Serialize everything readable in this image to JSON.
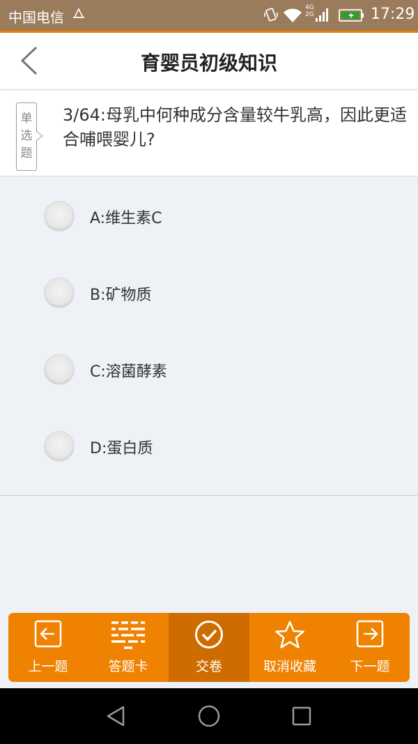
{
  "status_bar": {
    "carrier": "中国电信",
    "network": "4G\n2G",
    "time": "17:29"
  },
  "header": {
    "title": "育婴员初级知识"
  },
  "question": {
    "type_chars": [
      "单",
      "选",
      "题"
    ],
    "text": "3/64:母乳中何种成分含量较牛乳高，因此更适合哺喂婴儿?"
  },
  "options": [
    {
      "label": "A:维生素C",
      "selected": false
    },
    {
      "label": "B:矿物质",
      "selected": false
    },
    {
      "label": "C:溶菌酵素",
      "selected": false
    },
    {
      "label": "D:蛋白质",
      "selected": false
    }
  ],
  "toolbar": {
    "items": [
      {
        "label": "上一题",
        "icon": "arrow-left-box-icon"
      },
      {
        "label": "答题卡",
        "icon": "answer-card-icon"
      },
      {
        "label": "交卷",
        "icon": "check-circle-icon"
      },
      {
        "label": "取消收藏",
        "icon": "star-icon"
      },
      {
        "label": "下一题",
        "icon": "arrow-right-box-icon"
      }
    ],
    "active_index": 2
  },
  "colors": {
    "accent": "#ef8200",
    "accent_active": "#cf6c00",
    "status_bar": "#9a7b5c",
    "background": "#eef1f5"
  },
  "nav_bar": {
    "icons": [
      "back-triangle-icon",
      "home-circle-icon",
      "recents-square-icon"
    ]
  }
}
